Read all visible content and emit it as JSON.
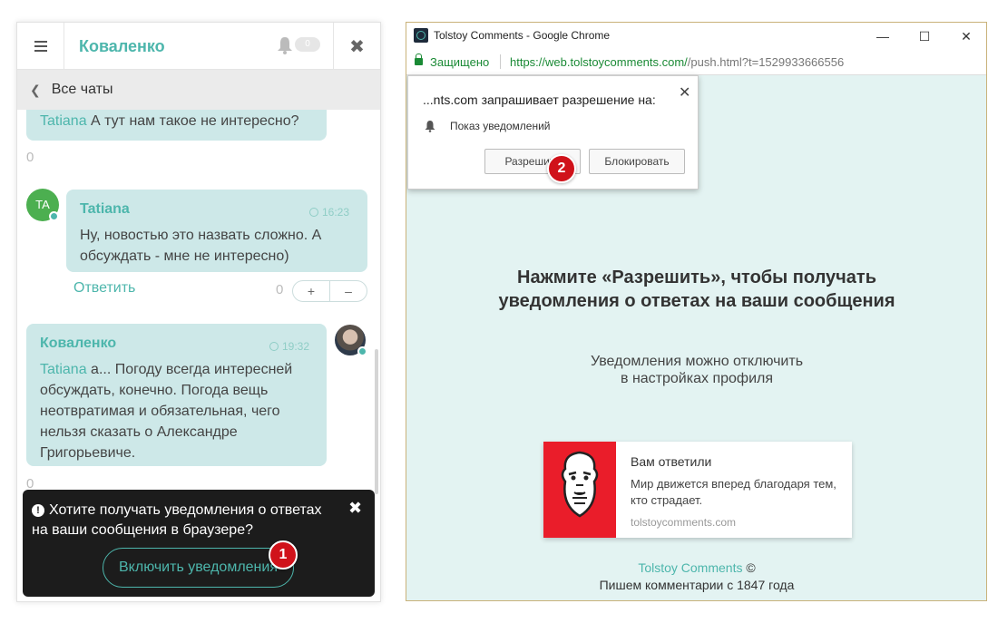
{
  "left_widget": {
    "title": "Коваленко",
    "notif_count": "0",
    "all_chats": "Все чаты",
    "messages": [
      {
        "mention": "Tatiana",
        "text": " А тут нам такое не интересно?",
        "votes": "0"
      },
      {
        "author": "Tatiana",
        "avatar_initials": "TA",
        "time": "16:23",
        "text": "Ну, новостью это назвать сложно. А обсуждать - мне не интересно)",
        "reply": "Ответить",
        "votes": "0",
        "plus": "+",
        "minus": "–"
      },
      {
        "author": "Коваленко",
        "time": "19:32",
        "mention": "Tatiana",
        "text": " а... Погоду всегда интересней обсуждать, конечно. Погода вещь неотвратимая и обязательная, чего нельзя сказать о Александре Григорьевиче.",
        "votes": "0"
      }
    ],
    "prompt": {
      "text": "Хотите получать уведомления о ответах на ваши сообщения в браузере?",
      "button": "Включить уведомления",
      "step": "1"
    }
  },
  "browser": {
    "window_title": "Tolstoy Comments - Google Chrome",
    "secure_label": "Защищено",
    "url_main": "https://web.tolstoycomments.com/",
    "url_rest": "/push.html?t=1529933666556",
    "permission": {
      "title": "...nts.com запрашивает разрешение на:",
      "item": "Показ уведомлений",
      "allow": "Разрешить",
      "block": "Блокировать",
      "step": "2"
    },
    "cta_title": "Нажмите «Разрешить», чтобы получать уведомления о ответах на ваши сообщения",
    "cta_sub_1": "Уведомления можно отключить",
    "cta_sub_2": "в настройках профиля",
    "push": {
      "title": "Вам ответили",
      "body": "Мир движется вперед благодаря тем, кто страдает.",
      "domain": "tolstoycomments.com"
    },
    "footer_brand": "Tolstoy Comments",
    "footer_copy": " ©",
    "footer_line2": "Пишем комментарии с 1847 года"
  },
  "colors": {
    "accent": "#4db6ac",
    "bubble": "#cde8e8",
    "badge_red": "#d0121a",
    "logo_red": "#ea1d2a"
  },
  "icons": [
    "menu-icon",
    "bell-icon",
    "close-icon",
    "chevron-left-icon",
    "clock-icon",
    "alert-icon",
    "lock-icon",
    "app-icon",
    "tolstoy-logo"
  ]
}
